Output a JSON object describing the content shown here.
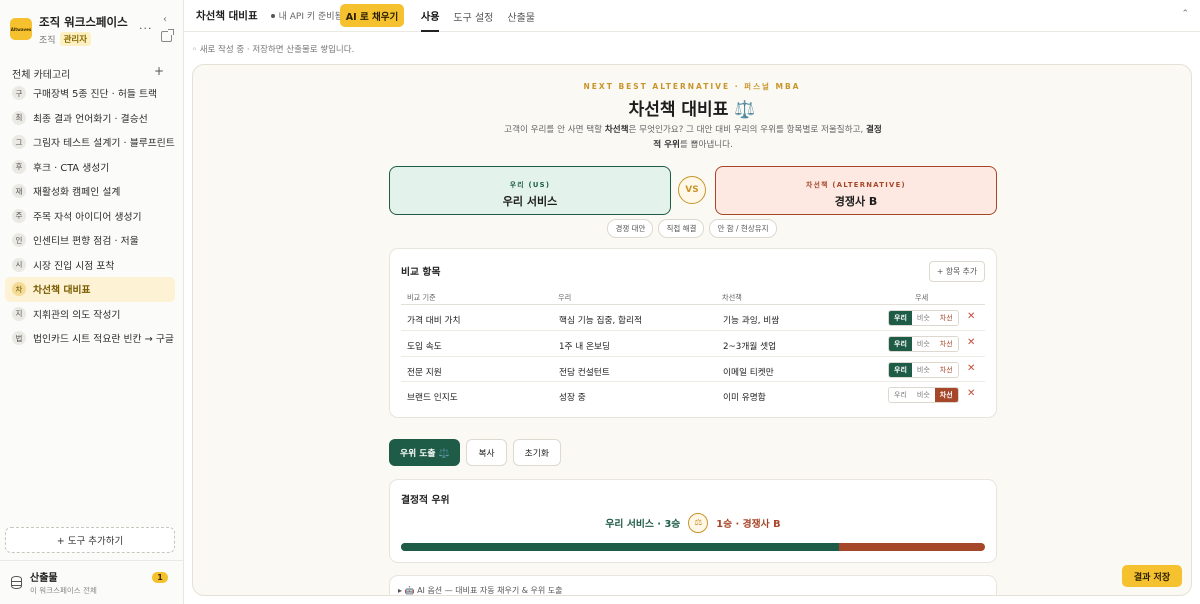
{
  "workspace": {
    "logo_text": "Altwaves",
    "title": "조직 워크스페이스",
    "org_label": "조직",
    "role_badge": "관리자",
    "more_glyph": "···",
    "collapse_glyph": "‹"
  },
  "sidebar": {
    "category_header": "전체 카테고리",
    "add_glyph": "+",
    "items": [
      {
        "initial": "구",
        "label": "구매장벽 5종 진단 · 허들 트랙",
        "active": false
      },
      {
        "initial": "최",
        "label": "최종 결과 언어화기 · 결승선",
        "active": false
      },
      {
        "initial": "그",
        "label": "그림자 테스트 설계기 · 블루프린트",
        "active": false
      },
      {
        "initial": "후",
        "label": "후크 · CTA 생성기",
        "active": false
      },
      {
        "initial": "재",
        "label": "재활성화 캠페인 설계",
        "active": false
      },
      {
        "initial": "주",
        "label": "주목 자석 아이디어 생성기",
        "active": false
      },
      {
        "initial": "인",
        "label": "인센티브 편향 점검 · 저울",
        "active": false
      },
      {
        "initial": "시",
        "label": "시장 진입 시점 포착",
        "active": false
      },
      {
        "initial": "차",
        "label": "차선책 대비표",
        "active": true
      },
      {
        "initial": "지",
        "label": "지휘관의 의도 작성기",
        "active": false
      },
      {
        "initial": "법",
        "label": "법인카드 시트 적요란 빈칸 → 구글...",
        "active": false
      }
    ],
    "add_tool_label": "+ 도구 추가하기",
    "outputs": {
      "title": "산출물",
      "subtitle": "이 워크스페이스 전체",
      "count": "1"
    }
  },
  "topbar": {
    "title": "차선책 대비표",
    "status": "내 API 키 준비됨",
    "ai_fill_label": "AI 로 채우기",
    "tabs": [
      {
        "label": "사용",
        "active": true
      },
      {
        "label": "도구 설정",
        "active": false
      },
      {
        "label": "산출물",
        "active": false
      }
    ],
    "collapse_glyph": "⌃"
  },
  "draft_note": "◦ 새로 작성 중 · 저장하면 산출물로 쌓입니다.",
  "tool": {
    "eyebrow": "NEXT BEST ALTERNATIVE · 퍼스널 MBA",
    "title": "차선책 대비표 ⚖️",
    "desc_part1": "고객이 우리를 안 사면 택할 ",
    "desc_bold1": "차선책",
    "desc_part2": "은 무엇인가요? 그 대안 대비 우리의 우위를 항목별로 저울질하고, ",
    "desc_bold2": "결정적 우위",
    "desc_part3": "를 뽑아냅니다.",
    "us_label": "우리 (US)",
    "us_name": "우리 서비스",
    "vs_label": "VS",
    "alt_label": "차선책 (ALTERNATIVE)",
    "alt_name": "경쟁사 B",
    "chips": [
      "경쟁 대안",
      "직접 해결",
      "안 함 / 현상유지"
    ]
  },
  "comparison": {
    "title": "비교 항목",
    "add_label": "+ 항목 추가",
    "headers": {
      "criterion": "비교 기준",
      "us": "우리",
      "alt": "차선책",
      "advantage": "우세"
    },
    "seg_labels": {
      "us": "우리",
      "even": "비슷",
      "alt": "차선"
    },
    "delete_glyph": "✕",
    "rows": [
      {
        "criterion": "가격 대비 가치",
        "us": "핵심 기능 집중, 합리적",
        "alt": "기능 과잉, 비쌈",
        "winner": "us"
      },
      {
        "criterion": "도입 속도",
        "us": "1주 내 온보딩",
        "alt": "2~3개월 셋업",
        "winner": "us"
      },
      {
        "criterion": "전문 지원",
        "us": "전담 컨설턴트",
        "alt": "이메일 티켓만",
        "winner": "us"
      },
      {
        "criterion": "브랜드 인지도",
        "us": "성장 중",
        "alt": "이미 유명함",
        "winner": "alt"
      }
    ]
  },
  "actions": {
    "derive": "우위 도출 ⚖️",
    "copy": "복사",
    "reset": "초기화"
  },
  "result": {
    "title": "결정적 우위",
    "us_score": "우리 서비스 · 3승",
    "icon_glyph": "⚖",
    "alt_score": "1승 · 경쟁사 B",
    "us_share": 0.75
  },
  "ai_options_label": "▸ 🤖 AI 옵션 — 대비표 자동 채우기 & 우위 도출",
  "save_label": "결과 저장",
  "colors": {
    "brand_yellow": "#f5c12e",
    "us_green": "#1f5c47",
    "alt_red": "#a7472a",
    "gold": "#c8952a"
  }
}
